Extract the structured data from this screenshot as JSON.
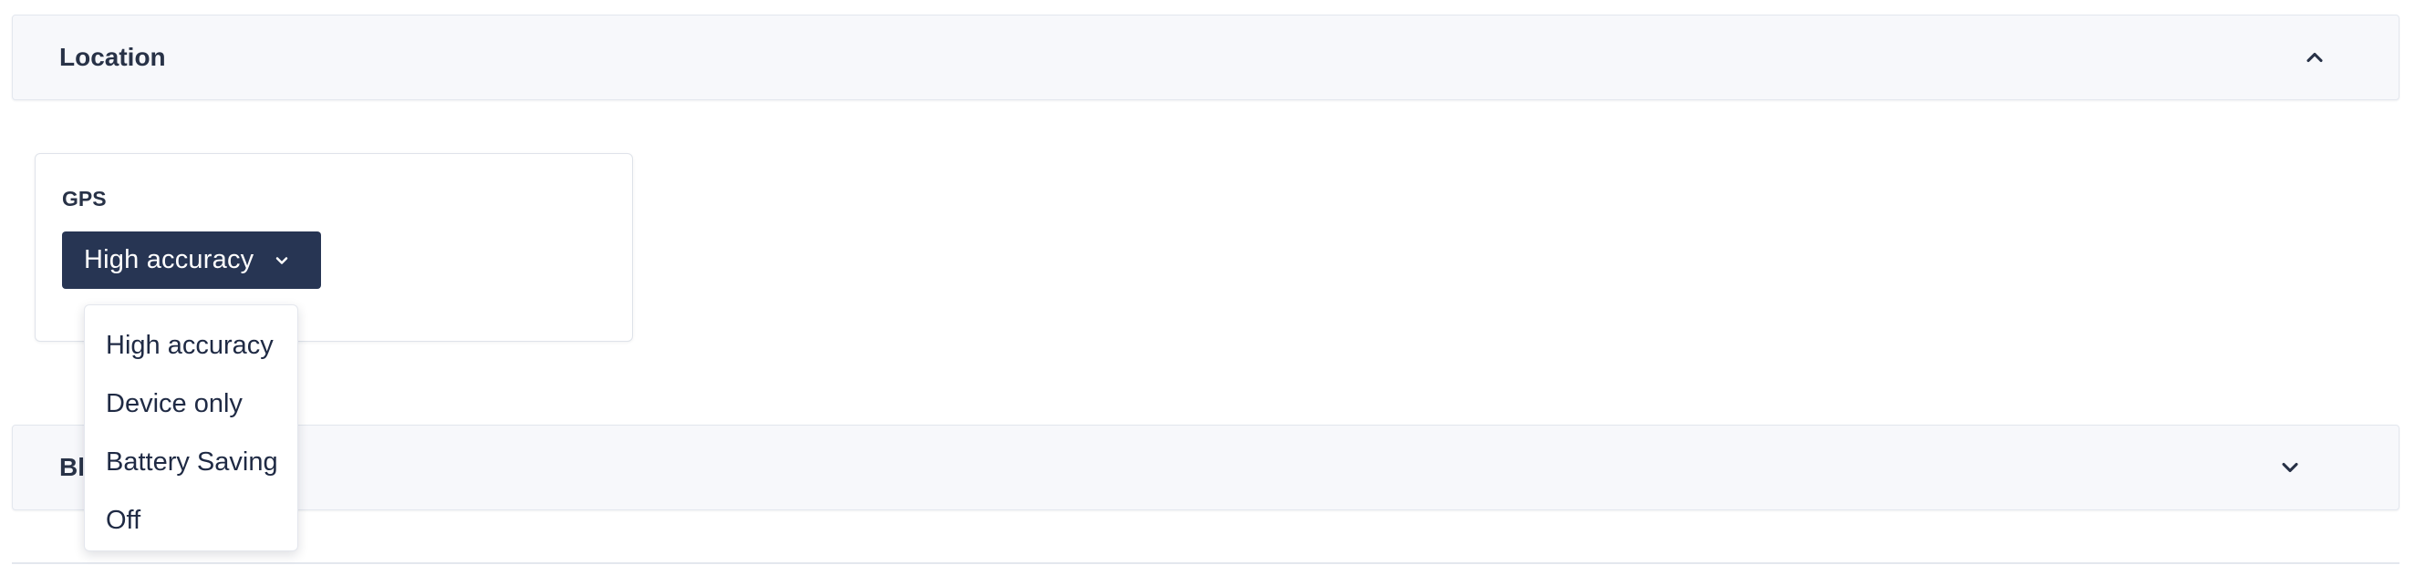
{
  "sections": {
    "location": {
      "title": "Location",
      "chevron_icon": "chevron-up-icon",
      "expanded": true
    },
    "bluetooth": {
      "title": "Bluetooth",
      "chevron_icon": "chevron-down-icon",
      "expanded": false
    }
  },
  "gps": {
    "label": "GPS",
    "selected": "High accuracy",
    "button_icon": "chevron-down-icon",
    "options": [
      "High accuracy",
      "Device only",
      "Battery Saving",
      "Off"
    ]
  },
  "colors": {
    "button_bg": "#273553",
    "panel_bg": "#f7f8fb",
    "text": "#1f2a3d"
  }
}
